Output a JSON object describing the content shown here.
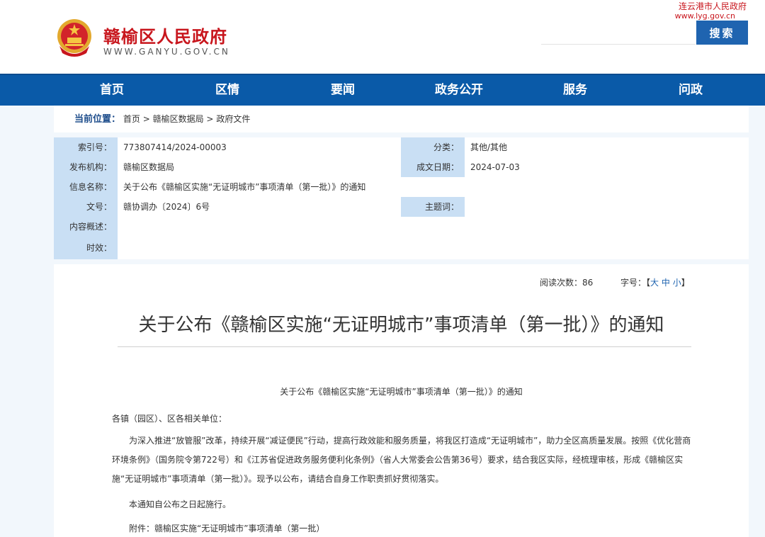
{
  "header": {
    "site_name": "赣榆区人民政府",
    "site_url": "WWW.GANYU.GOV.CN",
    "parent_site_name": "连云港市人民政府",
    "parent_site_url": "www.lyg.gov.cn",
    "search_placeholder": "",
    "search_button": "搜索"
  },
  "nav": {
    "items": [
      "首页",
      "区情",
      "要闻",
      "政务公开",
      "服务",
      "问政"
    ]
  },
  "breadcrumb": {
    "label": "当前位置：",
    "items": [
      "首页",
      "赣榆区数据局",
      "政府文件"
    ],
    "separator": ">"
  },
  "info": {
    "index_label": "索引号：",
    "index_value": "773807414/2024-00003",
    "category_label": "分类：",
    "category_value": "其他/其他",
    "issuer_label": "发布机构：",
    "issuer_value": "赣榆区数据局",
    "date_label": "成文日期：",
    "date_value": "2024-07-03",
    "name_label": "信息名称：",
    "name_value": "关于公布《赣榆区实施“无证明城市”事项清单（第一批）》的通知",
    "docno_label": "文号：",
    "docno_value": "赣协调办〔2024〕6号",
    "keyword_label": "主题词：",
    "keyword_value": "",
    "summary_label": "内容概述：",
    "summary_value": "",
    "validity_label": "时效：",
    "validity_value": ""
  },
  "article": {
    "views_label": "阅读次数：",
    "views_count": "86",
    "font_label": "字号：",
    "font_bracket_open": "【",
    "font_large": "大",
    "font_medium": "中",
    "font_small": "小",
    "font_bracket_close": "】",
    "title": "关于公布《赣榆区实施“无证明城市”事项清单（第一批）》的通知",
    "doc_heading": "关于公布《赣榆区实施“无证明城市”事项清单（第一批）》的通知",
    "salutation": "各镇（园区）、区各相关单位：",
    "paragraph_1": "为深入推进“放管服”改革，持续开展“减证便民”行动，提高行政效能和服务质量，将我区打造成“无证明城市”，助力全区高质量发展。按照《优化营商环境条例》（国务院令第722号）和《江苏省促进政务服务便利化条例》（省人大常委会公告第36号）要求，结合我区实际，经梳理审核，形成《赣榆区实施“无证明城市”事项清单（第一批）》。现予以公布，请结合自身工作职责抓好贯彻落实。",
    "paragraph_2": "本通知自公布之日起施行。",
    "paragraph_3": "附件：赣榆区实施“无证明城市”事项清单（第一批）"
  }
}
